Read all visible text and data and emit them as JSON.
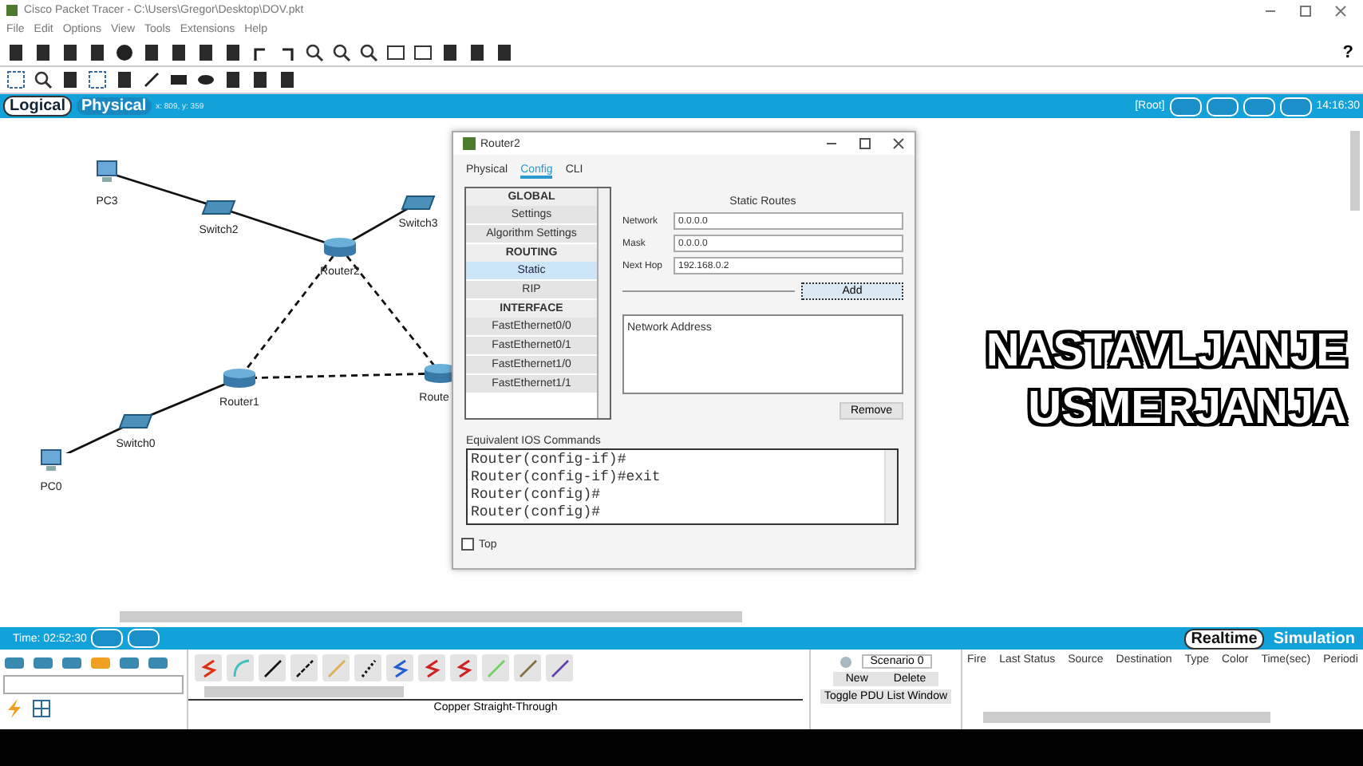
{
  "window": {
    "title": "Cisco Packet Tracer - C:\\Users\\Gregor\\Desktop\\DOV.pkt"
  },
  "menu": [
    "File",
    "Edit",
    "Options",
    "View",
    "Tools",
    "Extensions",
    "Help"
  ],
  "help_label": "?",
  "workspace_tabs": [
    {
      "label": "Logical",
      "selected": true
    },
    {
      "label": "Physical",
      "selected": false
    }
  ],
  "coordinates": "x: 809, y: 359",
  "root_label": "[Root]",
  "clock": "14:16:30",
  "devices": [
    {
      "label": "PC3",
      "kind": "pc"
    },
    {
      "label": "Switch2",
      "kind": "switch"
    },
    {
      "label": "Router2",
      "kind": "router"
    },
    {
      "label": "Switch3",
      "kind": "switch"
    },
    {
      "label": "Router1",
      "kind": "router"
    },
    {
      "label": "Switch0",
      "kind": "switch"
    },
    {
      "label": "PC0",
      "kind": "pc"
    },
    {
      "label": "Route",
      "kind": "router"
    }
  ],
  "router_dialog": {
    "title": "Router2",
    "tabs": [
      {
        "label": "Physical",
        "selected": false
      },
      {
        "label": "Config",
        "selected": true
      },
      {
        "label": "CLI",
        "selected": false
      }
    ],
    "sidebar": [
      {
        "label": "GLOBAL",
        "kind": "header"
      },
      {
        "label": "Settings",
        "kind": "item",
        "selected": false
      },
      {
        "label": "Algorithm Settings",
        "kind": "item",
        "selected": false
      },
      {
        "label": "ROUTING",
        "kind": "header"
      },
      {
        "label": "Static",
        "kind": "item",
        "selected": true
      },
      {
        "label": "RIP",
        "kind": "item",
        "selected": false
      },
      {
        "label": "INTERFACE",
        "kind": "header"
      },
      {
        "label": "FastEthernet0/0",
        "kind": "item",
        "selected": false
      },
      {
        "label": "FastEthernet0/1",
        "kind": "item",
        "selected": false
      },
      {
        "label": "FastEthernet1/0",
        "kind": "item",
        "selected": false
      },
      {
        "label": "FastEthernet1/1",
        "kind": "item",
        "selected": false
      }
    ],
    "section_title": "Static Routes",
    "fields": [
      {
        "label": "Network",
        "value": "0.0.0.0"
      },
      {
        "label": "Mask",
        "value": "0.0.0.0"
      },
      {
        "label": "Next Hop",
        "value": "192.168.0.2"
      }
    ],
    "add_button": "Add",
    "list_header": "Network Address",
    "remove_button": "Remove",
    "ios_label": "Equivalent IOS Commands",
    "ios_lines": [
      "Router(config-if)#",
      "Router(config-if)#exit",
      "Router(config)#",
      "Router(config)#"
    ],
    "top_checkbox": {
      "label": "Top",
      "checked": false
    }
  },
  "overlay_caption": [
    "NASTAVLJANJE",
    "USMERJANJA"
  ],
  "time": "Time: 02:52:30",
  "modes": [
    {
      "label": "Realtime",
      "selected": true
    },
    {
      "label": "Simulation",
      "selected": false
    }
  ],
  "connection_name": "Copper Straight-Through",
  "scenario": "Scenario 0",
  "pdu_buttons": [
    "New",
    "Delete"
  ],
  "toggle_button": "Toggle PDU List Window",
  "pdu_columns": [
    "Fire",
    "Last Status",
    "Source",
    "Destination",
    "Type",
    "Color",
    "Time(sec)",
    "Periodi"
  ]
}
